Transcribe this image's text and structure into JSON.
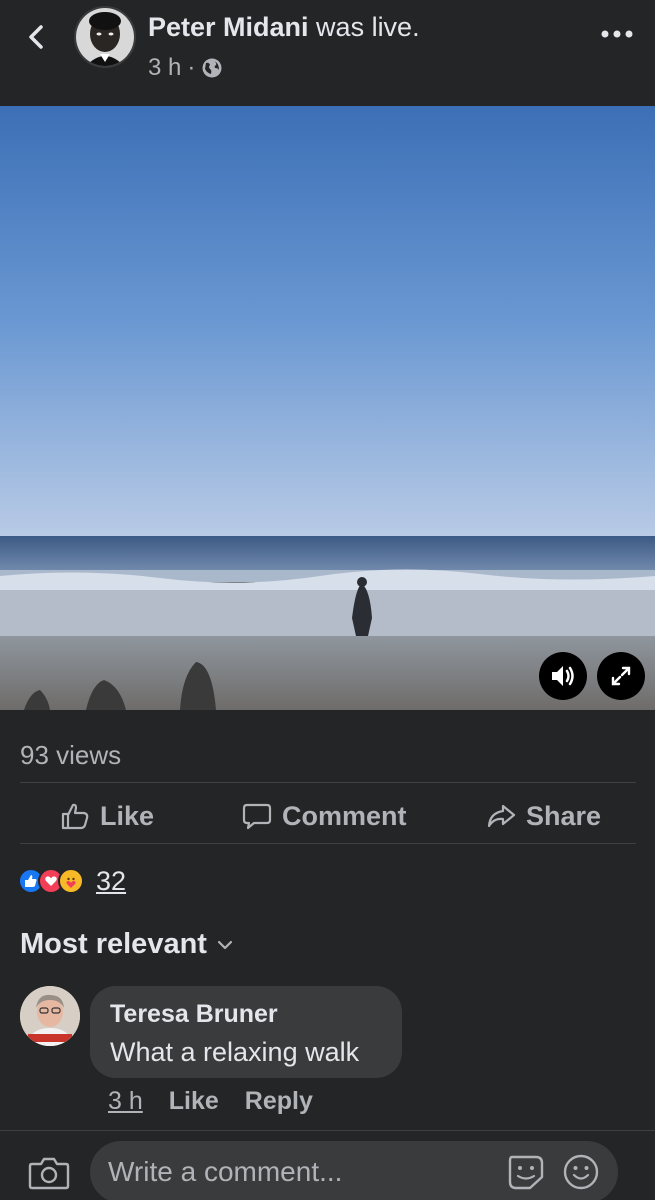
{
  "header": {
    "author_name": "Peter Midani",
    "action_text": " was live.",
    "time": "3 h",
    "separator": "·",
    "privacy_icon": "globe-icon",
    "back_icon": "chevron-left-icon",
    "more_icon": "more-dots-icon"
  },
  "video": {
    "volume_icon": "speaker-icon",
    "expand_icon": "expand-icon"
  },
  "stats": {
    "views": "93 views",
    "reaction_count": "32",
    "reaction_icons": [
      "like-reaction-icon",
      "love-reaction-icon",
      "care-reaction-icon"
    ]
  },
  "actions": {
    "like": "Like",
    "comment": "Comment",
    "share": "Share"
  },
  "comments": {
    "sort_label": "Most relevant",
    "items": [
      {
        "author": "Teresa Bruner",
        "text": "What a relaxing walk",
        "time": "3 h",
        "like_label": "Like",
        "reply_label": "Reply"
      }
    ]
  },
  "composer": {
    "placeholder": "Write a comment..."
  },
  "colors": {
    "background": "#242526",
    "bubble": "#3a3b3c",
    "text_primary": "#e4e6eb",
    "text_secondary": "#b0b3b8",
    "like_blue": "#1877f2",
    "love_red": "#f33e58"
  }
}
